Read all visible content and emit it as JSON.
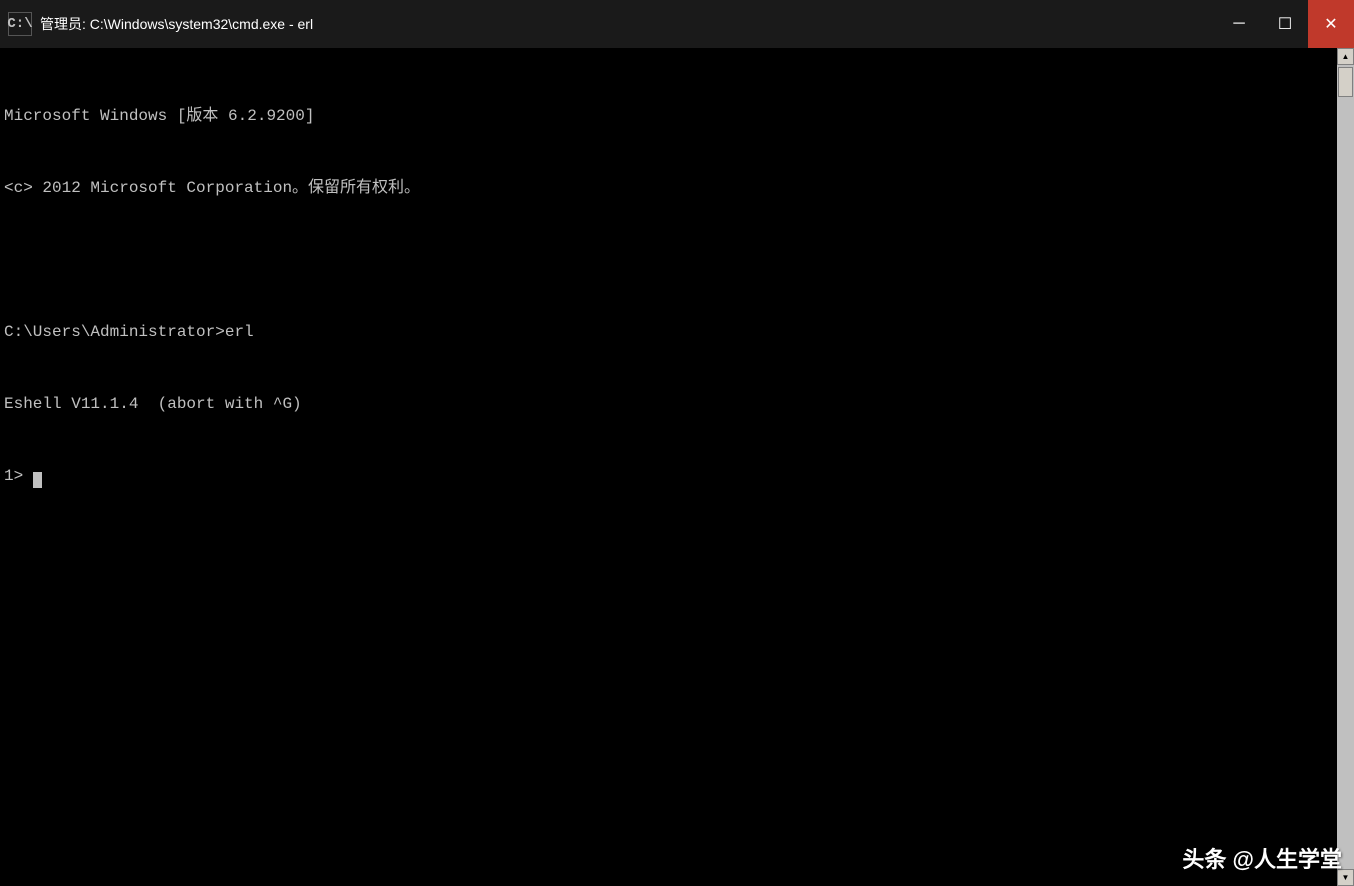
{
  "titleBar": {
    "icon": "C:\\",
    "title": "管理员: C:\\Windows\\system32\\cmd.exe - erl",
    "minimizeLabel": "─",
    "maximizeLabel": "☐",
    "closeLabel": "✕"
  },
  "console": {
    "lines": [
      "Microsoft Windows [版本 6.2.9200]",
      "<c> 2012 Microsoft Corporation。保留所有权利。",
      "",
      "C:\\Users\\Administrator>erl",
      "Eshell V11.1.4  (abort with ^G)",
      "1> "
    ]
  },
  "watermark": {
    "text": "头条 @人生学堂"
  }
}
